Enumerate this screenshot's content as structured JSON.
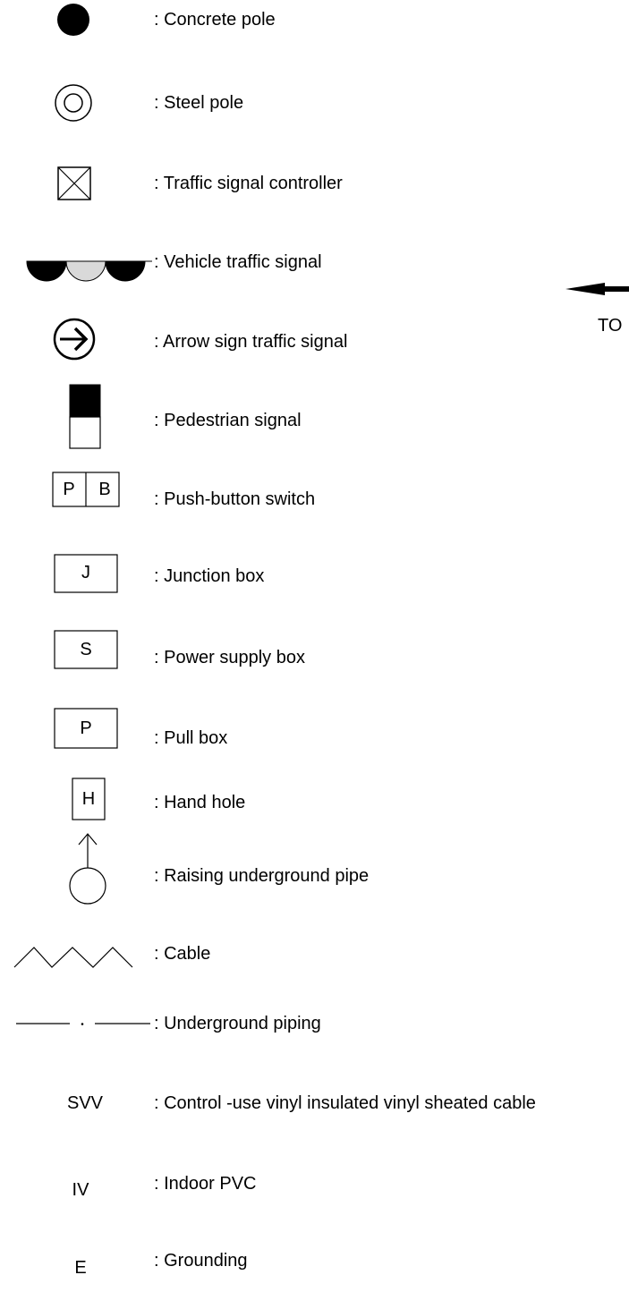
{
  "legend": {
    "items": [
      {
        "symbol": "concrete-pole",
        "label": ": Concrete pole"
      },
      {
        "symbol": "steel-pole",
        "label": ": Steel pole"
      },
      {
        "symbol": "traffic-signal-controller",
        "label": ": Traffic signal controller"
      },
      {
        "symbol": "vehicle-traffic-signal",
        "label": ": Vehicle traffic signal"
      },
      {
        "symbol": "arrow-sign-traffic-signal",
        "label": ": Arrow sign traffic signal"
      },
      {
        "symbol": "pedestrian-signal",
        "label": ": Pedestrian signal"
      },
      {
        "symbol": "push-button-switch",
        "label": ": Push-button switch",
        "code": "P B"
      },
      {
        "symbol": "junction-box",
        "label": ": Junction box",
        "code": "J"
      },
      {
        "symbol": "power-supply-box",
        "label": ": Power supply box",
        "code": "S"
      },
      {
        "symbol": "pull-box",
        "label": ": Pull box",
        "code": "P"
      },
      {
        "symbol": "hand-hole",
        "label": ": Hand hole",
        "code": "H"
      },
      {
        "symbol": "raising-underground-pipe",
        "label": ": Raising underground pipe"
      },
      {
        "symbol": "cable",
        "label": ": Cable"
      },
      {
        "symbol": "underground-piping",
        "label": ": Underground piping"
      },
      {
        "symbol": "svv",
        "label": ": Control -use vinyl insulated vinyl sheated cable",
        "code": "SVV"
      },
      {
        "symbol": "iv",
        "label": ": Indoor PVC",
        "code": "IV"
      },
      {
        "symbol": "e",
        "label": ": Grounding",
        "code": "E"
      }
    ]
  },
  "direction": {
    "text": "TO"
  }
}
